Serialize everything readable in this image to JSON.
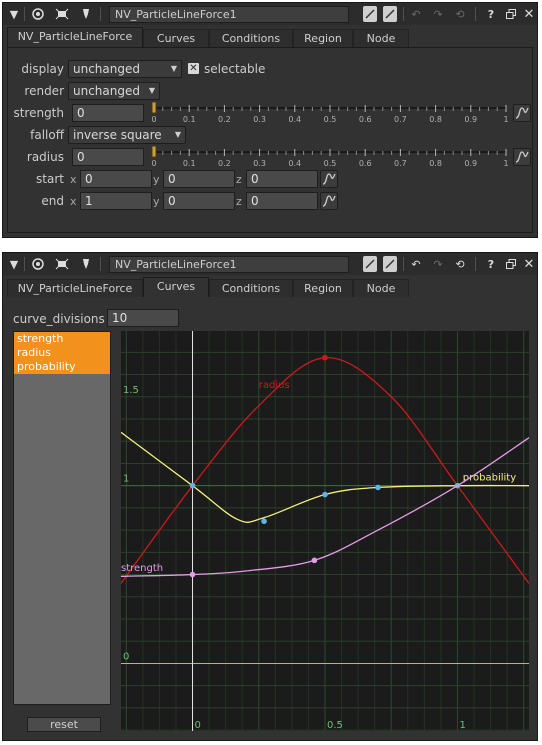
{
  "panel1": {
    "title": "NV_ParticleLineForce1",
    "tabs": [
      "NV_ParticleLineForce",
      "Curves",
      "Conditions",
      "Region",
      "Node"
    ],
    "active_tab": 0,
    "display": {
      "label": "display",
      "value": "unchanged",
      "checkbox_label": "selectable",
      "checked": true
    },
    "render": {
      "label": "render",
      "value": "unchanged"
    },
    "strength": {
      "label": "strength",
      "value": "0",
      "slider_value": 0
    },
    "falloff": {
      "label": "falloff",
      "value": "inverse square"
    },
    "radius": {
      "label": "radius",
      "value": "0",
      "slider_value": 0
    },
    "slider_ticks": [
      "0",
      "0.1",
      "0.2",
      "0.3",
      "0.4",
      "0.5",
      "0.6",
      "0.7",
      "0.8",
      "0.9",
      "1"
    ],
    "start": {
      "label": "start",
      "x_label": "x",
      "y_label": "y",
      "z_label": "z",
      "x": "0",
      "y": "0",
      "z": "0"
    },
    "end": {
      "label": "end",
      "x_label": "x",
      "y_label": "y",
      "z_label": "z",
      "x": "1",
      "y": "0",
      "z": "0"
    }
  },
  "panel2": {
    "title": "NV_ParticleLineForce1",
    "tabs": [
      "NV_ParticleLineForce",
      "Curves",
      "Conditions",
      "Region",
      "Node"
    ],
    "active_tab": 1,
    "curve_divisions": {
      "label": "curve_divisions",
      "value": "10"
    },
    "curve_list": [
      "strength",
      "radius",
      "probability"
    ],
    "reset_label": "reset"
  },
  "colors": {
    "panel_bg": "#323232",
    "selection": "#f2911b",
    "radius_curve": "#cc1a1a",
    "probability_curve": "#f0f07a",
    "strength_curve": "#e49be8",
    "key_point": "#5ab4e6",
    "axis_zero": "#6fdc6f"
  },
  "chart_data": {
    "type": "line",
    "x_tick_labels": [
      "0",
      "0.5",
      "1"
    ],
    "y_tick_labels": [
      "0",
      "1",
      "1.5"
    ],
    "grid": true,
    "xlim": [
      -0.27,
      1.27
    ],
    "ylim": [
      -0.38,
      1.87
    ],
    "series": [
      {
        "name": "radius",
        "color": "#cc1a1a",
        "label_at": [
          0.25,
          1.55
        ],
        "points": [
          [
            -0.27,
            0.45
          ],
          [
            0,
            1.0
          ],
          [
            0.25,
            1.45
          ],
          [
            0.5,
            1.72
          ],
          [
            0.75,
            1.5
          ],
          [
            1.0,
            1.0
          ],
          [
            1.27,
            0.45
          ]
        ],
        "keys": [
          [
            0.5,
            1.72
          ]
        ]
      },
      {
        "name": "probability",
        "color": "#f0f07a",
        "label_at": [
          1.02,
          1.03
        ],
        "points": [
          [
            -0.27,
            1.3
          ],
          [
            0,
            1.0
          ],
          [
            0.17,
            0.81
          ],
          [
            0.27,
            0.82
          ],
          [
            0.5,
            0.95
          ],
          [
            0.7,
            0.99
          ],
          [
            1.0,
            1.0
          ],
          [
            1.27,
            1.0
          ]
        ],
        "keys": [
          [
            0,
            1.0
          ],
          [
            0.27,
            0.8
          ],
          [
            0.5,
            0.95
          ],
          [
            0.7,
            0.99
          ],
          [
            1.0,
            1.0
          ]
        ]
      },
      {
        "name": "strength",
        "color": "#e49be8",
        "label_at": [
          -0.27,
          0.52
        ],
        "points": [
          [
            -0.27,
            0.49
          ],
          [
            0,
            0.5
          ],
          [
            0.2,
            0.52
          ],
          [
            0.46,
            0.58
          ],
          [
            0.7,
            0.75
          ],
          [
            1.0,
            1.0
          ],
          [
            1.27,
            1.27
          ]
        ],
        "keys": [
          [
            0,
            0.5
          ],
          [
            0.46,
            0.58
          ]
        ]
      }
    ]
  }
}
